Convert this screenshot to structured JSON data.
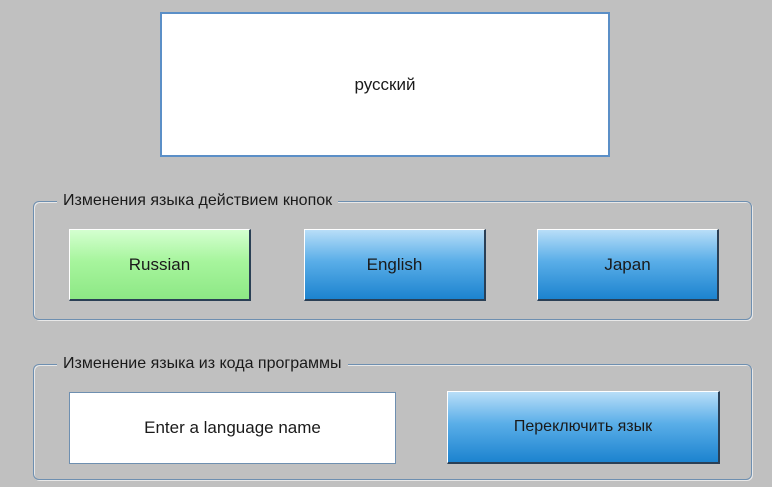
{
  "display": {
    "language_text": "русский"
  },
  "button_group": {
    "legend": "Изменения языка действием кнопок",
    "buttons": [
      {
        "label": "Russian",
        "color": "#a7f59d",
        "state": "selected"
      },
      {
        "label": "English",
        "color": "#5aaee8",
        "state": "normal"
      },
      {
        "label": "Japan",
        "color": "#5aaee8",
        "state": "normal"
      }
    ]
  },
  "code_group": {
    "legend": "Изменение языка из кода программы",
    "input": {
      "value": "",
      "placeholder": "Enter a language name"
    },
    "switch_button_label": "Переключить язык"
  },
  "colors": {
    "background": "#c0c0c0",
    "accent_blue": "#1c83cf",
    "accent_green": "#8de885",
    "border": "#6e8fb0"
  }
}
